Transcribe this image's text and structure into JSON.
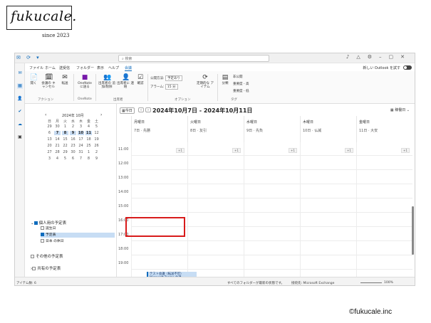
{
  "brand": {
    "logo": "fukucale.",
    "since": "since 2023",
    "copyright": "©fukucale.inc"
  },
  "search": {
    "placeholder": "検索"
  },
  "menu": {
    "items": [
      "ファイル",
      "ホーム",
      "送受信",
      "フォルダー",
      "表示",
      "ヘルプ",
      "会議"
    ],
    "new_outlook": "新しい Outlook を試す"
  },
  "ribbon": {
    "buttons": [
      {
        "label": "開く",
        "icon": "open-icon"
      },
      {
        "label": "会議の\nキャンセル",
        "icon": "cancel-meeting-icon"
      },
      {
        "label": "転送",
        "icon": "forward-icon"
      },
      {
        "label": "OneNote\nに送る",
        "icon": "onenote-icon"
      },
      {
        "label": "出席者の\n追加/削除",
        "icon": "add-attendees-icon"
      },
      {
        "label": "出席者に\n連絡",
        "icon": "contact-attendees-icon"
      },
      {
        "label": "確認",
        "icon": "check-icon"
      },
      {
        "label": "定期的な\nアイテム",
        "icon": "recurrence-icon"
      },
      {
        "label": "分類",
        "icon": "categorize-icon"
      }
    ],
    "groups": [
      "アクション",
      "OneNote",
      "出席者",
      "オプション",
      "タグ"
    ],
    "status": "公開方法:",
    "status_value": "予定あり",
    "alarm": "アラーム:",
    "alarm_value": "15 分",
    "tags": [
      "非公開",
      "重要度 - 高",
      "重要度 - 低"
    ]
  },
  "minical": {
    "title": "2024年 10月",
    "weekdays": [
      "日",
      "月",
      "火",
      "水",
      "木",
      "金",
      "土"
    ],
    "weeks": [
      [
        "29",
        "30",
        "1",
        "2",
        "3",
        "4",
        "5"
      ],
      [
        "6",
        "7",
        "8",
        "9",
        "10",
        "11",
        "12"
      ],
      [
        "13",
        "14",
        "15",
        "16",
        "17",
        "18",
        "19"
      ],
      [
        "20",
        "21",
        "22",
        "23",
        "24",
        "25",
        "26"
      ],
      [
        "27",
        "28",
        "29",
        "30",
        "31",
        "1",
        "2"
      ],
      [
        "3",
        "4",
        "5",
        "6",
        "7",
        "8",
        "9"
      ]
    ]
  },
  "folders": {
    "my_calendars": "個人用の予定表",
    "items": [
      "誕生日",
      "予定表",
      "日本 の休日"
    ],
    "other": "その他の予定表",
    "shared": "共有の予定表"
  },
  "calendar": {
    "today": "今日",
    "range": "2024年10月7日 - 2024年10月11日",
    "view": "稼働日",
    "days": [
      {
        "name": "月曜日",
        "date": "7日 · 先勝"
      },
      {
        "name": "火曜日",
        "date": "8日 · 友引"
      },
      {
        "name": "水曜日",
        "date": "9日 · 先負"
      },
      {
        "name": "木曜日",
        "date": "10日 · 仏滅"
      },
      {
        "name": "金曜日",
        "date": "11日 · 大安"
      }
    ],
    "hours": [
      "11:00",
      "12:00",
      "13:00",
      "14:00",
      "15:00",
      "16:00",
      "17:00",
      "18:00",
      "19:00"
    ],
    "more": "+1",
    "event": {
      "title": "テスト会議（転送不可）",
      "location": "Microsoft Teams 会議"
    }
  },
  "status": {
    "items": "アイテム数: 6",
    "updated": "すべてのフォルダーが最新の状態です。",
    "connection": "接続先: Microsoft Exchange",
    "zoom": "100%"
  },
  "colors": {
    "accent": "#0f6cbd",
    "highlight": "#d81b1b",
    "event": "#c7ddf4"
  }
}
